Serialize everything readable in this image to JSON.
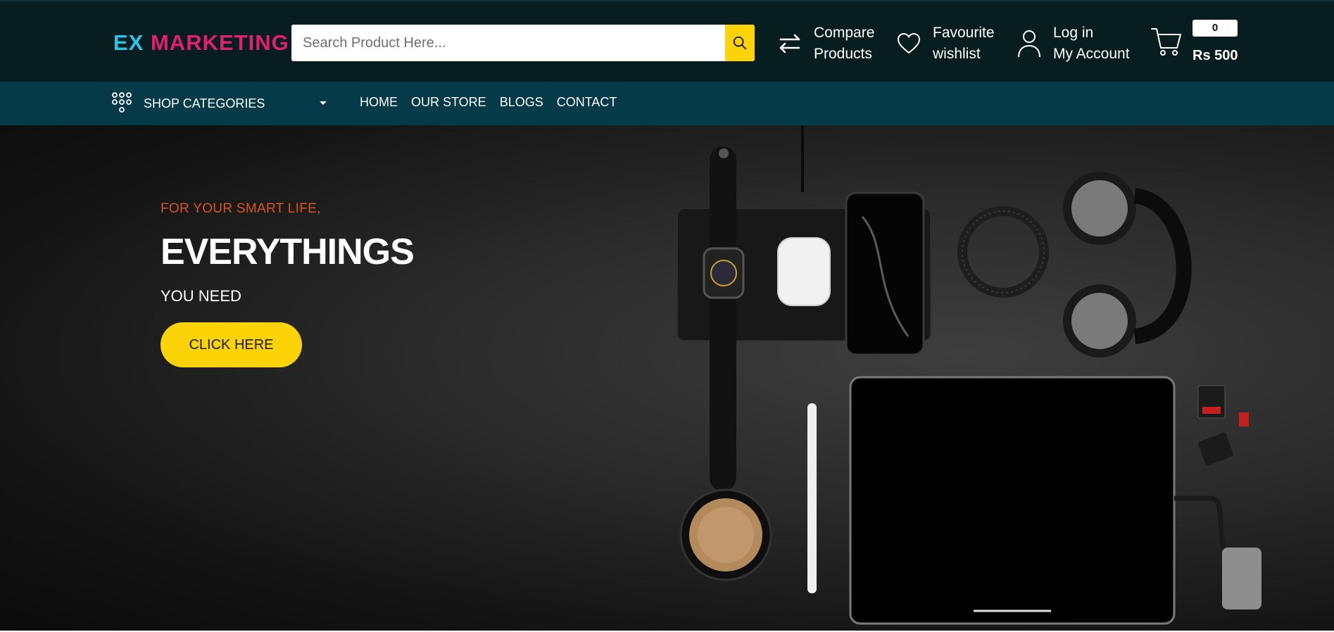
{
  "brand": {
    "logo_part1": "EX",
    "logo_part2": "MARKETING",
    "colors": {
      "part1": "#2cc2e8",
      "part2": "#e21f71"
    }
  },
  "search": {
    "placeholder": "Search Product Here...",
    "icon": "search-icon",
    "button_color": "#fbd307"
  },
  "header_links": [
    {
      "icon": "compare-arrows-icon",
      "line1": "Compare",
      "line2": "Products"
    },
    {
      "icon": "heart-icon",
      "line1": "Favourite",
      "line2": "wishlist"
    },
    {
      "icon": "user-icon",
      "line1": "Log in",
      "line2": "My Account"
    }
  ],
  "cart": {
    "icon": "cart-icon",
    "count": "0",
    "total": "Rs 500"
  },
  "nav": {
    "categories_icon": "grid-dots-icon",
    "categories_label": "SHOP CATEGORIES",
    "items": [
      "HOME",
      "OUR STORE",
      "BLOGS",
      "CONTACT"
    ]
  },
  "hero": {
    "tagline": "FOR YOUR SMART LIFE,",
    "headline": "EVERYTHINGS",
    "subline": "YOU NEED",
    "cta_label": "CLICK HERE",
    "accent_color": "#d9541e",
    "cta_color": "#fbd307"
  },
  "theme": {
    "topbar_bg": "#081d20",
    "navbar_bg": "#053a48"
  }
}
